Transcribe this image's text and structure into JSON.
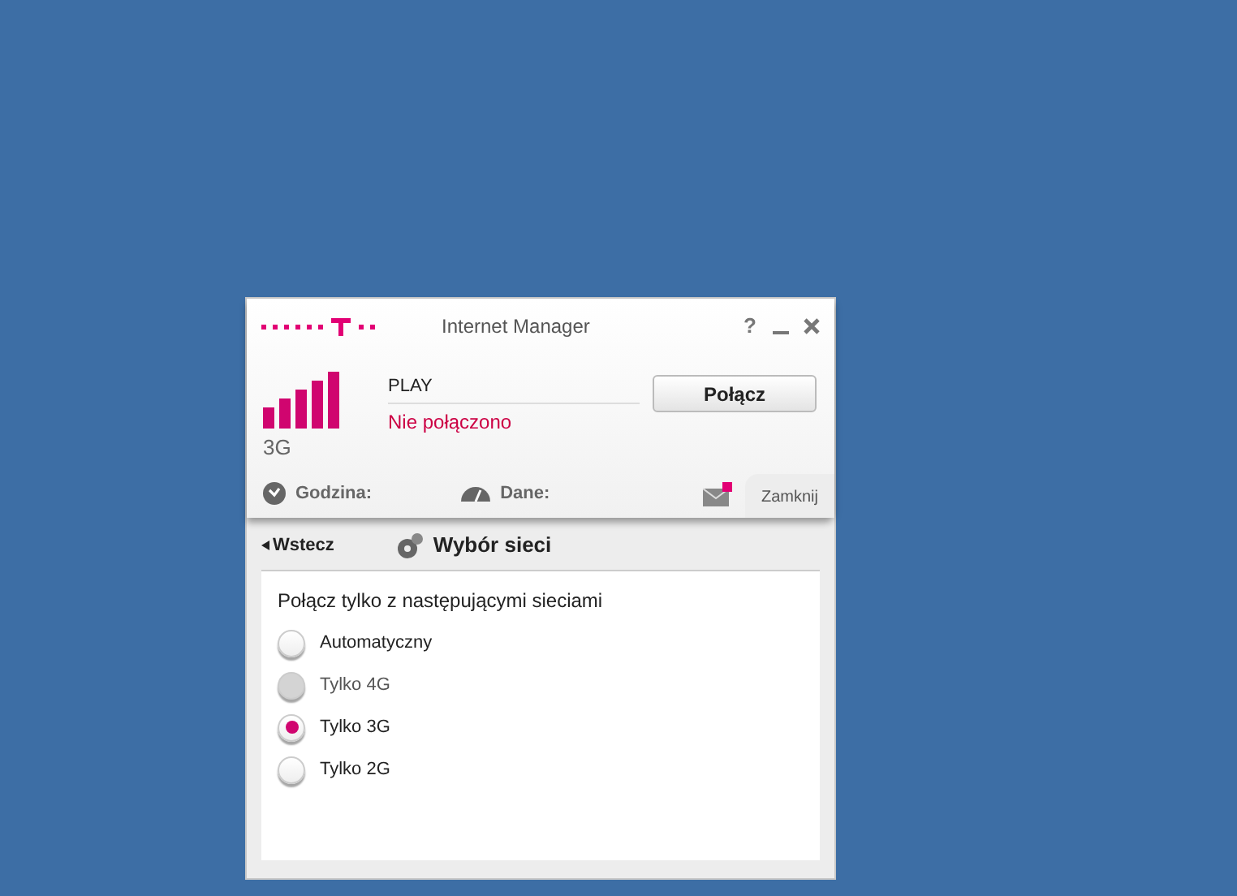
{
  "window": {
    "title": "Internet Manager",
    "help": "?"
  },
  "connection": {
    "network_type": "3G",
    "operator": "PLAY",
    "status": "Nie połączono",
    "connect_button": "Połącz"
  },
  "status_bar": {
    "time_label": "Godzina:",
    "data_label": "Dane:",
    "close_tab": "Zamknij"
  },
  "page": {
    "back": "Wstecz",
    "title": "Wybór sieci",
    "prompt": "Połącz tylko z następującymi sieciami"
  },
  "options": [
    {
      "label": "Automatyczny",
      "selected": false,
      "disabled": false
    },
    {
      "label": "Tylko 4G",
      "selected": false,
      "disabled": true
    },
    {
      "label": "Tylko 3G",
      "selected": true,
      "disabled": false
    },
    {
      "label": "Tylko 2G",
      "selected": false,
      "disabled": false
    }
  ]
}
